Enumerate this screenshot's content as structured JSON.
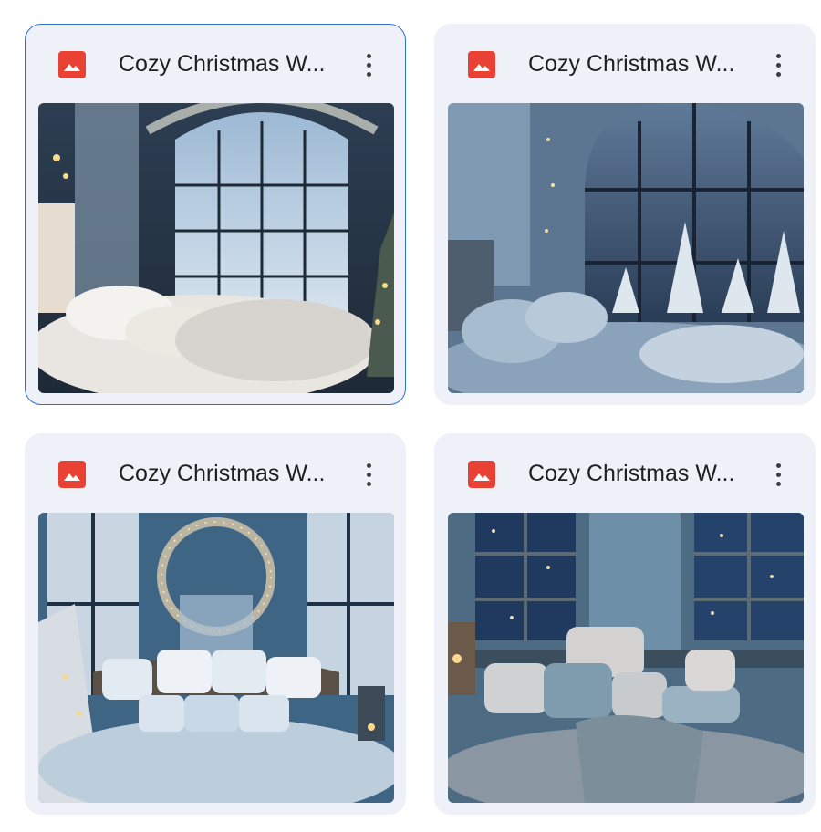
{
  "files": [
    {
      "title": "Cozy Christmas W...",
      "file_type": "image",
      "icon": "image-file-icon",
      "selected": true,
      "thumbnail": "bedroom-arched-window-snowy-forest"
    },
    {
      "title": "Cozy Christmas W...",
      "file_type": "image",
      "icon": "image-file-icon",
      "selected": false,
      "thumbnail": "bedroom-arched-window-snowy-trees-night"
    },
    {
      "title": "Cozy Christmas W...",
      "file_type": "image",
      "icon": "image-file-icon",
      "selected": false,
      "thumbnail": "bedroom-wreath-window-white-pillows"
    },
    {
      "title": "Cozy Christmas W...",
      "file_type": "image",
      "icon": "image-file-icon",
      "selected": false,
      "thumbnail": "bedroom-rustic-blue-wood-snowy-windows"
    }
  ],
  "colors": {
    "card_bg": "#eef2f8",
    "selected_border": "#2f6fd0",
    "image_icon": "#e94235",
    "title_text": "#1f1f1f"
  }
}
